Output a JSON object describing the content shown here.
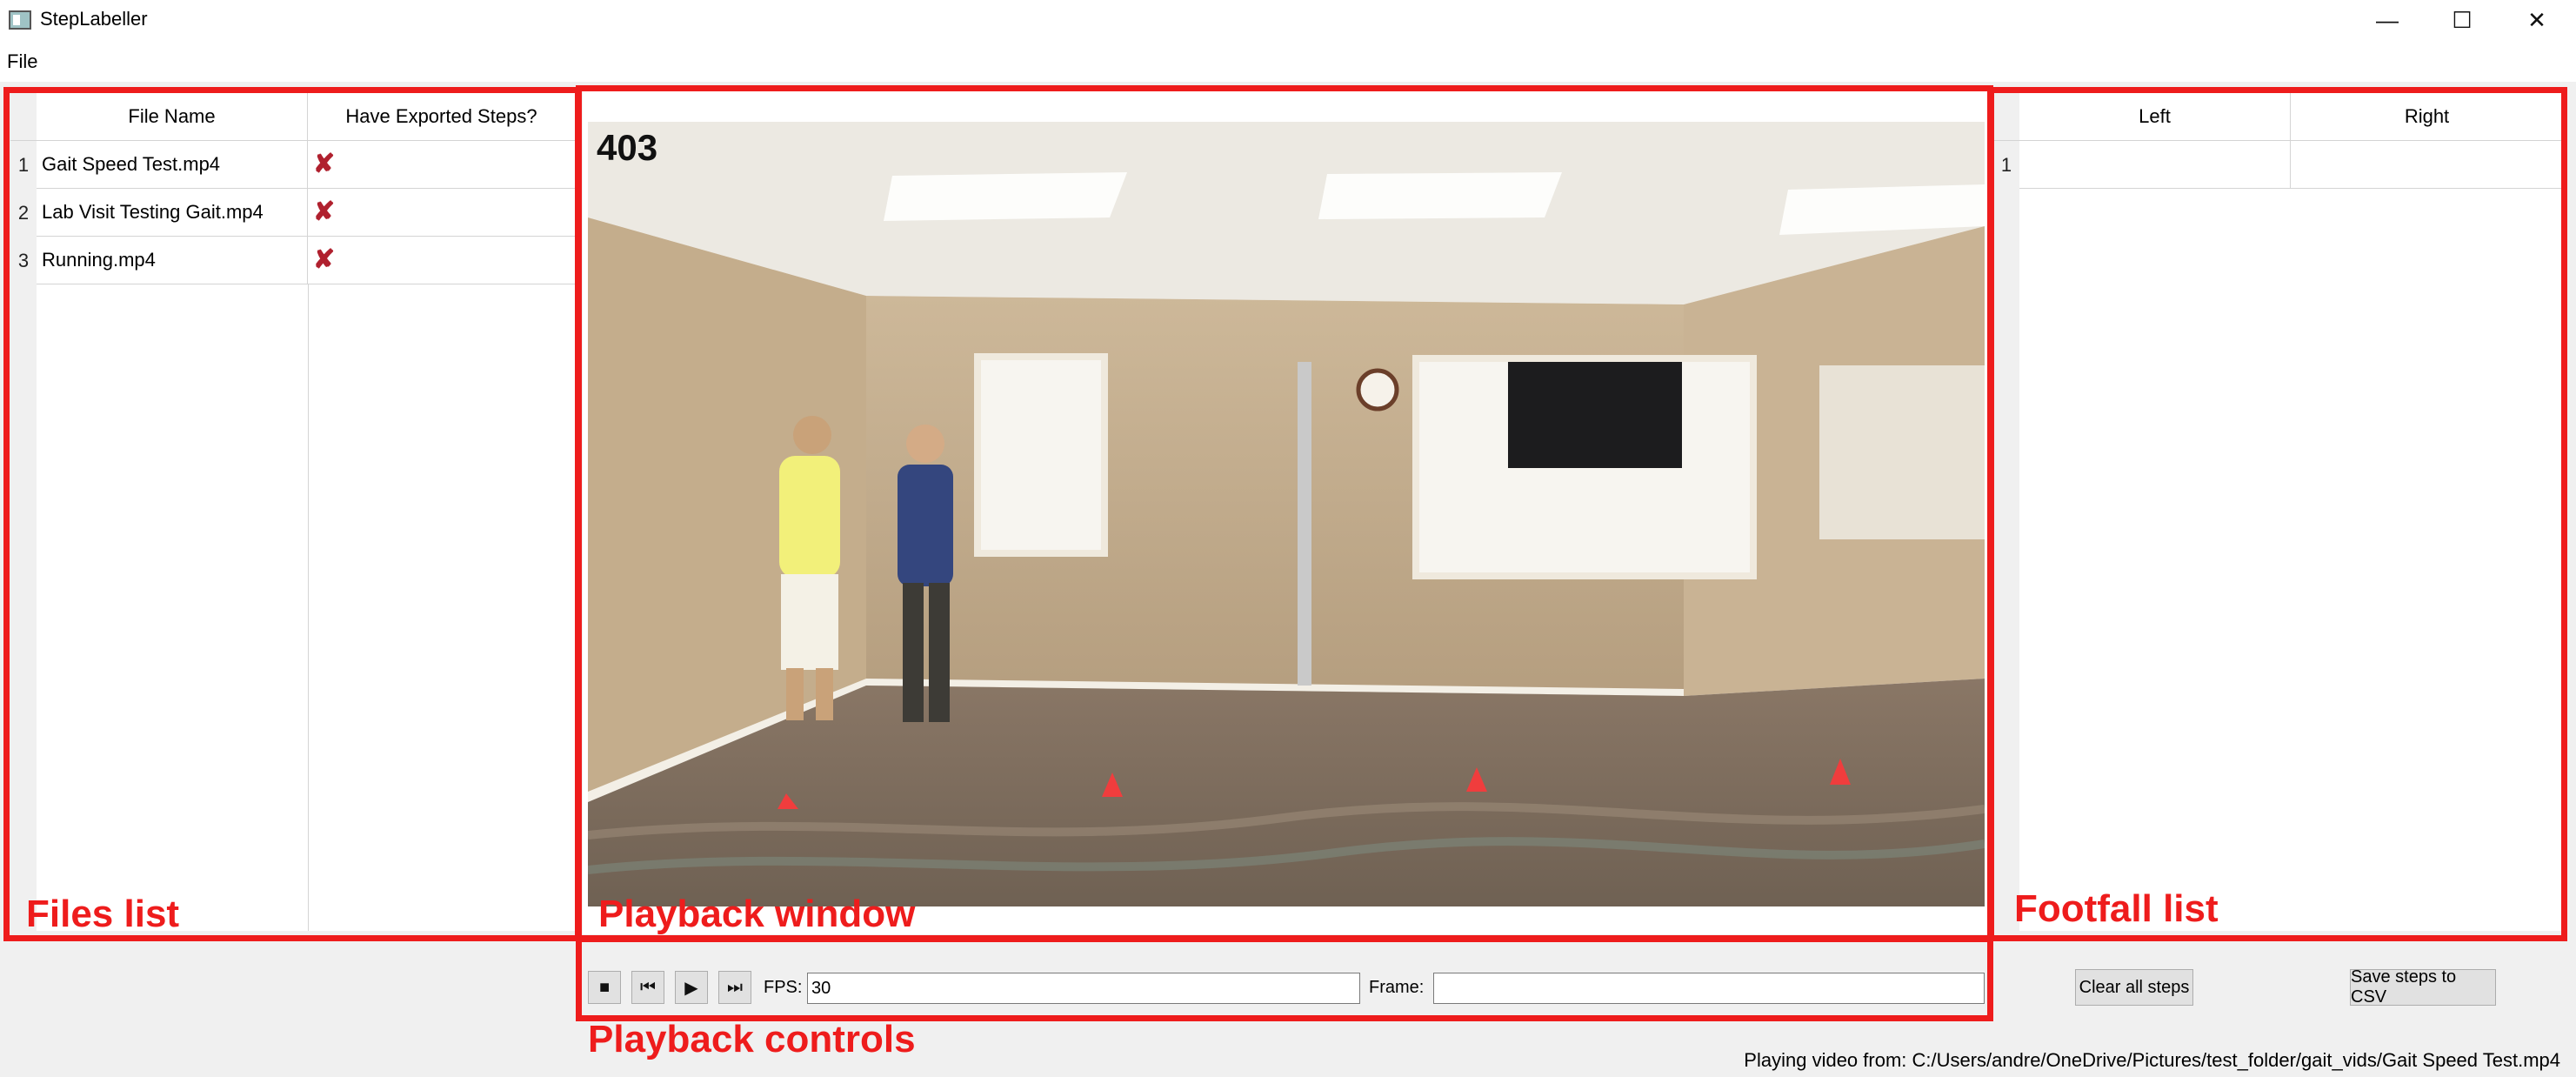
{
  "window": {
    "title": "StepLabeller",
    "controls": {
      "minimize": "—",
      "maximize": "☐",
      "close": "✕"
    }
  },
  "menu": {
    "file": "File"
  },
  "files_table": {
    "headers": [
      "File Name",
      "Have Exported Steps?"
    ],
    "rows": [
      {
        "num": "1",
        "name": "Gait Speed Test.mp4",
        "exported": "✘"
      },
      {
        "num": "2",
        "name": "Lab Visit Testing Gait.mp4",
        "exported": "✘"
      },
      {
        "num": "3",
        "name": "Running.mp4",
        "exported": "✘"
      }
    ]
  },
  "video": {
    "frame_number": "403"
  },
  "controls": {
    "fps_label": "FPS:",
    "fps_value": "30",
    "frame_label": "Frame:",
    "frame_value": ""
  },
  "footfall_table": {
    "headers": [
      "Left",
      "Right"
    ],
    "rows": [
      {
        "num": "1",
        "left": "",
        "right": ""
      }
    ]
  },
  "buttons": {
    "clear_all_steps": "Clear all steps",
    "save_steps_csv": "Save steps to CSV"
  },
  "annotations": {
    "files_list": "Files list",
    "playback_window": "Playback window",
    "footfall_list": "Footfall list",
    "playback_controls": "Playback controls"
  },
  "status_bar": "Playing video from: C:/Users/andre/OneDrive/Pictures/test_folder/gait_vids/Gait Speed Test.mp4",
  "colors": {
    "annotation_red": "#ee1c1c",
    "x_mark": "#b0202e"
  }
}
